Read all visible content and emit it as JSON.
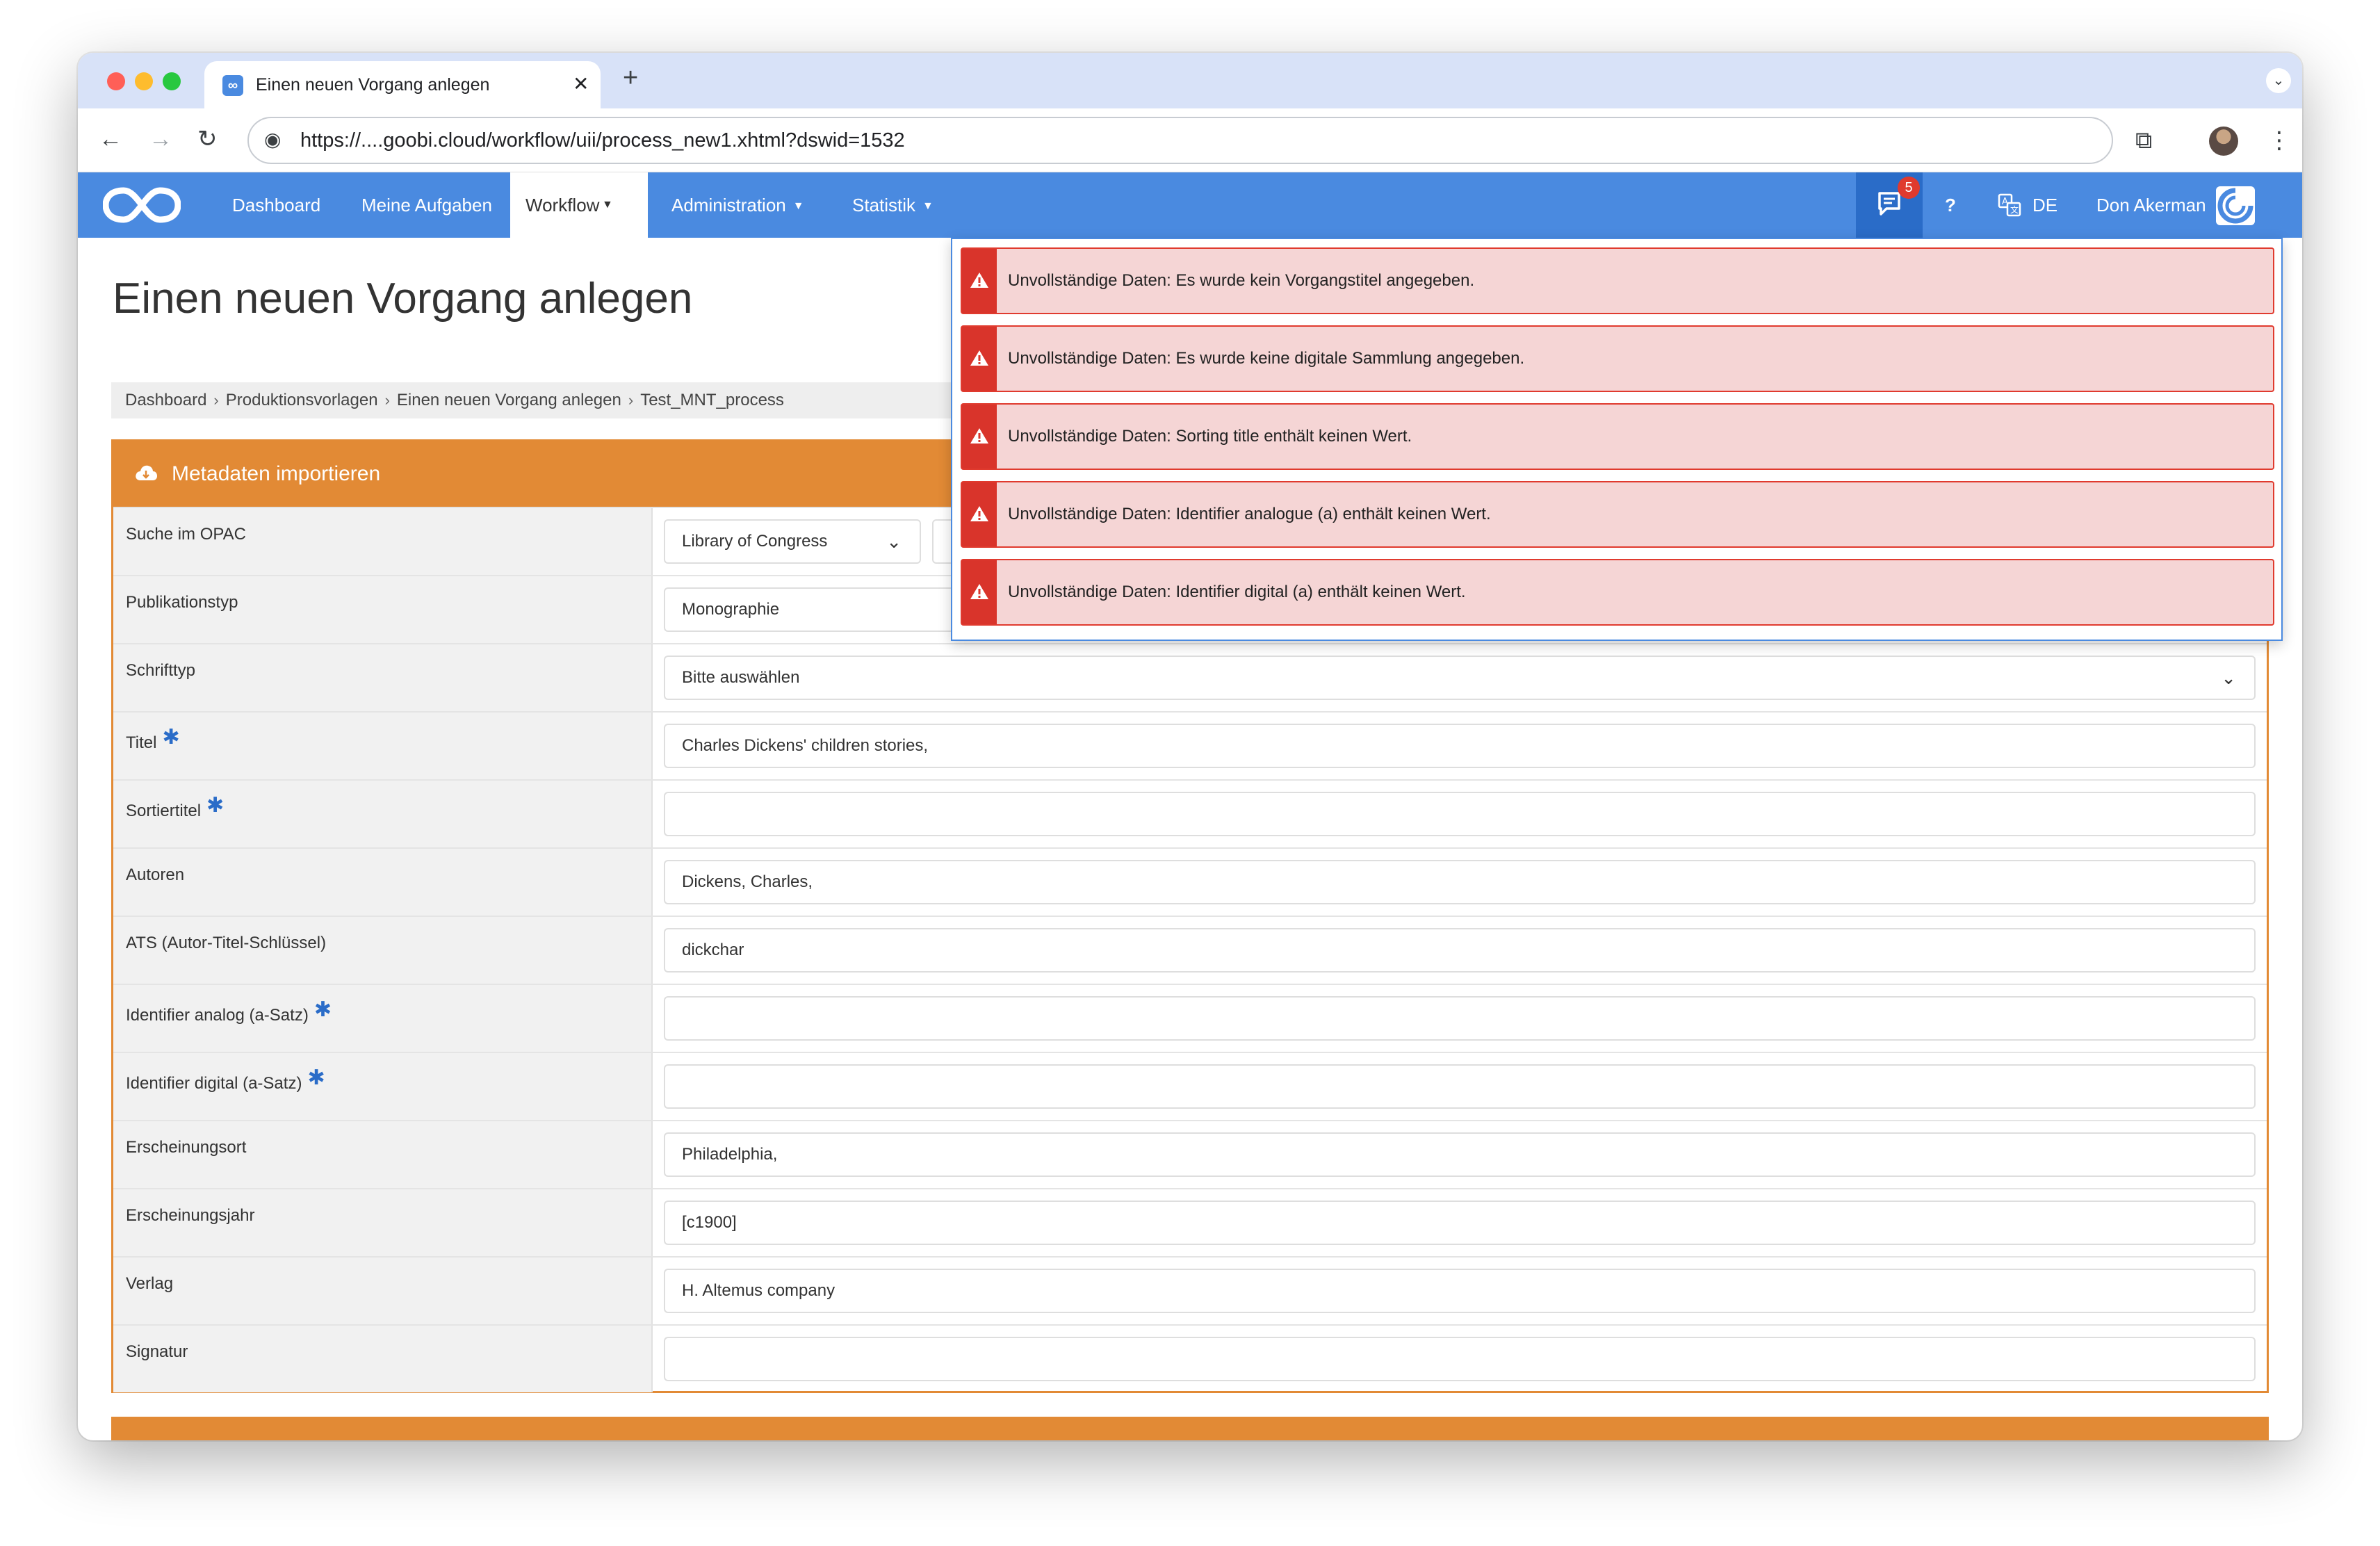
{
  "browser": {
    "tab_title": "Einen neuen Vorgang anlegen",
    "url": "https://....goobi.cloud/workflow/uii/process_new1.xhtml?dswid=1532",
    "new_tab_label": "+",
    "tab_close_label": "✕"
  },
  "navbar": {
    "items": [
      {
        "label": "Dashboard"
      },
      {
        "label": "Meine Aufgaben"
      },
      {
        "label": "Workflow"
      },
      {
        "label": "Administration"
      },
      {
        "label": "Statistik"
      }
    ],
    "notification_count": "5",
    "help_label": "?",
    "language": "DE",
    "user_name": "Don Akerman"
  },
  "page": {
    "title": "Einen neuen Vorgang anlegen",
    "breadcrumb": [
      "Dashboard",
      "Produktionsvorlagen",
      "Einen neuen Vorgang anlegen",
      "Test_MNT_process"
    ]
  },
  "metadata_box": {
    "header": "Metadaten importieren",
    "rows": [
      {
        "label": "Suche im OPAC",
        "value": "Library of Congress",
        "required": false
      },
      {
        "label": "Publikationstyp",
        "value": "Monographie",
        "required": false
      },
      {
        "label": "Schrifttyp",
        "value": "Bitte auswählen",
        "required": false
      },
      {
        "label": "Titel",
        "value": "Charles Dickens' children stories,",
        "required": true
      },
      {
        "label": "Sortiertitel",
        "value": "",
        "required": true
      },
      {
        "label": "Autoren",
        "value": "Dickens, Charles,",
        "required": false
      },
      {
        "label": "ATS (Autor-Titel-Schlüssel)",
        "value": "dickchar",
        "required": false
      },
      {
        "label": "Identifier analog (a-Satz)",
        "value": "",
        "required": true
      },
      {
        "label": "Identifier digital (a-Satz)",
        "value": "",
        "required": true
      },
      {
        "label": "Erscheinungsort",
        "value": "Philadelphia,",
        "required": false
      },
      {
        "label": "Erscheinungsjahr",
        "value": "[c1900]",
        "required": false
      },
      {
        "label": "Verlag",
        "value": "H. Altemus company",
        "required": false
      },
      {
        "label": "Signatur",
        "value": "",
        "required": false
      }
    ],
    "required_marker": "✱"
  },
  "notifications": [
    {
      "text": "Unvollständige Daten: Es wurde kein Vorgangstitel angegeben."
    },
    {
      "text": "Unvollständige Daten: Es wurde keine digitale Sammlung angegeben."
    },
    {
      "text": "Unvollständige Daten: Sorting title enthält keinen Wert."
    },
    {
      "text": "Unvollständige Daten: Identifier analogue (a) enthält keinen Wert."
    },
    {
      "text": "Unvollständige Daten: Identifier digital (a) enthält keinen Wert."
    }
  ],
  "colors": {
    "primary": "#4a8ae0",
    "accent_orange": "#e28a35",
    "alert_red": "#d9342b",
    "alert_bg": "#f5d5d5"
  },
  "icons": {
    "logo": "infinity-logo-icon",
    "messages": "message-icon",
    "language": "translate-icon",
    "cloud": "cloud-download-icon",
    "warning": "warning-triangle-icon"
  }
}
